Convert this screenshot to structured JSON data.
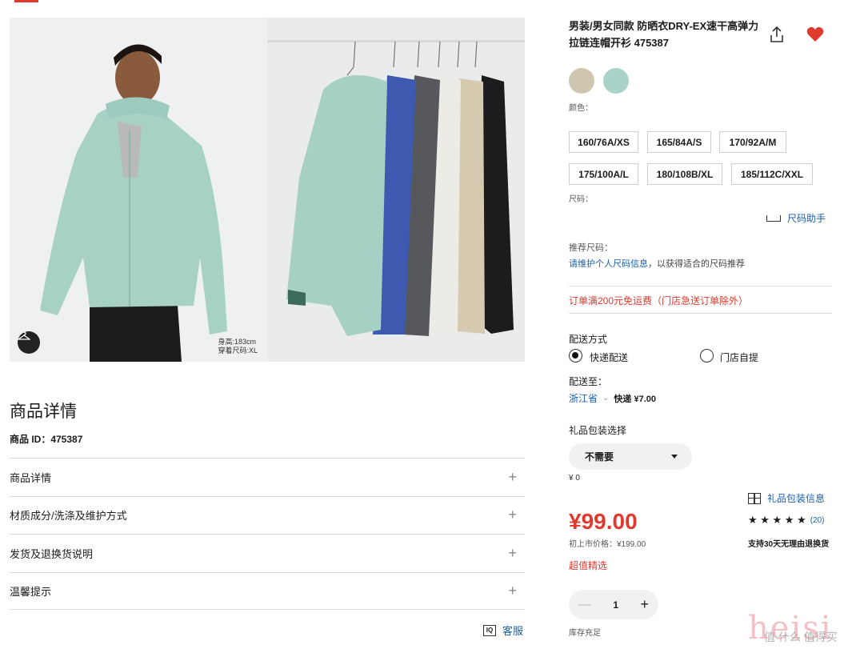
{
  "product": {
    "title": "男装/男女同款 防晒衣DRY-EX速干高弹力拉链连帽开衫 475387",
    "color_label": "颜色：",
    "colors": [
      "#cfc6b0",
      "#a9d3c8"
    ],
    "size_label": "尺码：",
    "sizes": [
      "160/76A/XS",
      "165/84A/S",
      "170/92A/M",
      "175/100A/L",
      "180/108B/XL",
      "185/112C/XXL"
    ],
    "size_help": "尺码助手",
    "recommend_label": "推荐尺码：",
    "recommend_link": "请维护个人尺码信息",
    "recommend_suffix": "，以获得适合的尺码推荐",
    "free_shipping": "订单满200元免运费（门店急送订单除外）"
  },
  "image": {
    "caption_line1": "身高:183cm",
    "caption_line2": "穿着尺码:XL"
  },
  "delivery": {
    "method_label": "配送方式",
    "option_express": "快递配送",
    "option_store": "门店自提",
    "to_label": "配送至：",
    "province": "浙江省",
    "chevron": "⌄",
    "express_fee": "快递 ¥7.00"
  },
  "gift": {
    "label": "礼品包装选择",
    "selected": "不需要",
    "price": "¥ 0",
    "info_link": "礼品包装信息"
  },
  "pricing": {
    "price": "¥99.00",
    "original": "初上市价格：¥199.00",
    "tag": "超值精选"
  },
  "rating": {
    "stars": "★ ★ ★ ★ ★",
    "count": "(20)",
    "return_policy": "支持30天无理由退换货"
  },
  "quantity": {
    "minus": "—",
    "value": "1",
    "plus": "+",
    "stock": "库存充足"
  },
  "details": {
    "title": "商品详情",
    "product_id": "商品 ID：475387",
    "sections": [
      "商品详情",
      "材质成分/洗涤及维护方式",
      "发货及退换货说明",
      "温馨提示"
    ],
    "plus": "+"
  },
  "service": {
    "icon_text": "IQ",
    "label": "客服"
  },
  "watermark": {
    "main": "heisi",
    "sub": "值 什么 值得买"
  }
}
